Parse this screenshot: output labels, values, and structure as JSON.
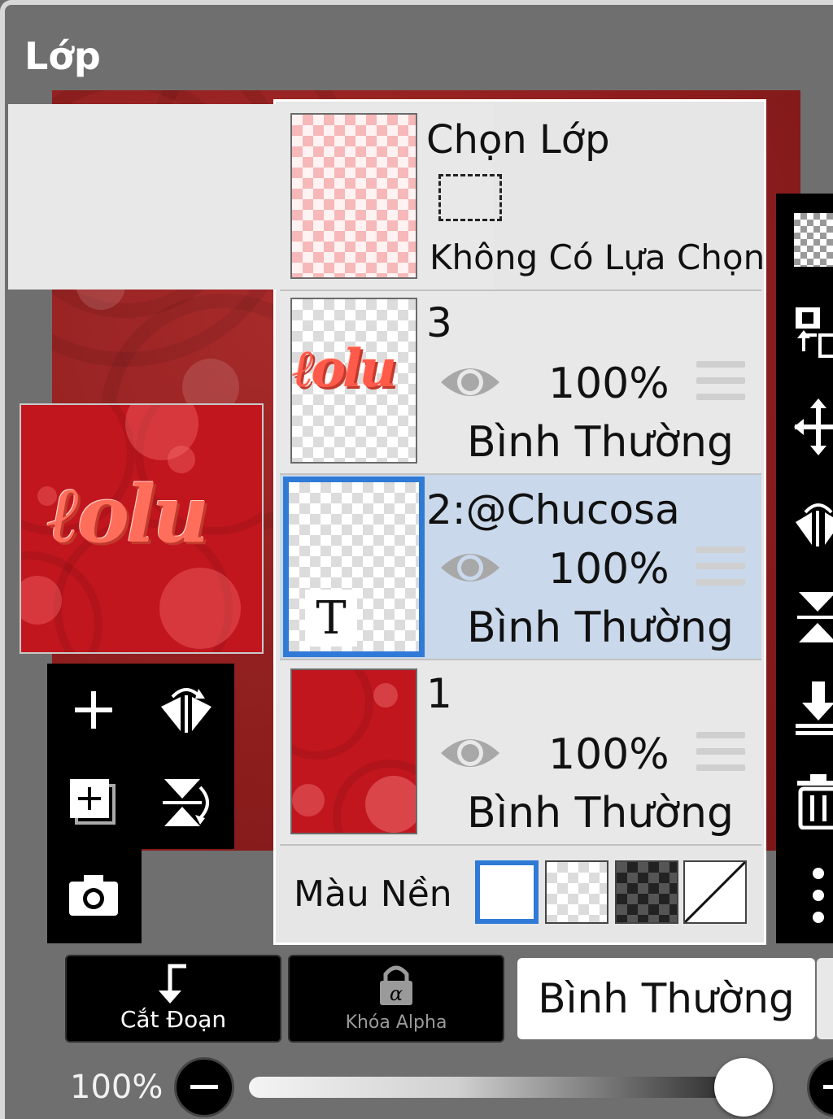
{
  "title": "Lớp",
  "selection_layer": {
    "label": "Chọn Lớp",
    "status": "Không Có Lựa Chọn"
  },
  "layers": [
    {
      "name": "3",
      "opacity": "100%",
      "blend": "Bình Thường"
    },
    {
      "name": "2:@Chucosa",
      "opacity": "100%",
      "blend": "Bình Thường",
      "selected": true,
      "thumb_glyph": "T"
    },
    {
      "name": "1",
      "opacity": "100%",
      "blend": "Bình Thường"
    }
  ],
  "background_color": {
    "label": "Màu Nền",
    "options": [
      "white",
      "light-checker",
      "dark-checker",
      "transparent"
    ],
    "selected": "white"
  },
  "bottom": {
    "clip_label": "Cắt Đoạn",
    "alpha_lock_label": "Khóa Alpha",
    "blend_mode": "Bình Thường",
    "opacity_label": "100%",
    "opacity_value": 0.95
  },
  "colors": {
    "accent": "#2f7ad6",
    "selected_row": "#c9d8ea",
    "art_red": "#c1161e"
  }
}
